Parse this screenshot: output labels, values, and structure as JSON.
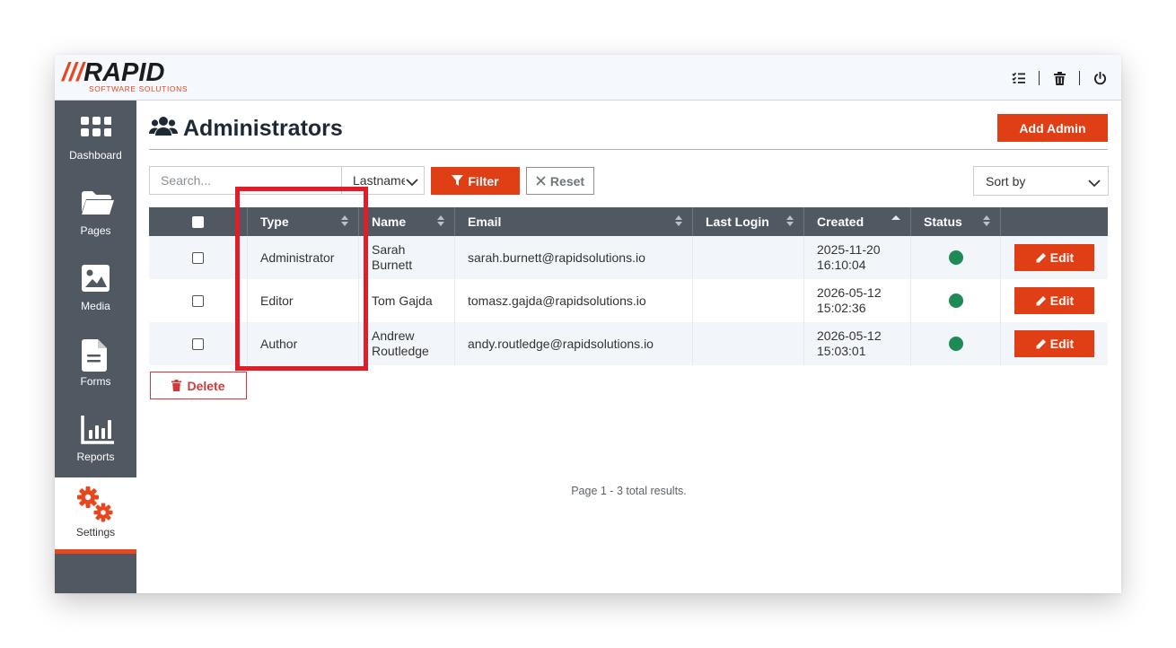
{
  "brand": {
    "name": "RAPID",
    "slashes": "///",
    "tagline": "SOFTWARE SOLUTIONS"
  },
  "topbar": {
    "icons": [
      "checklist-icon",
      "trash-icon",
      "power-icon"
    ]
  },
  "sidebar": {
    "items": [
      {
        "label": "Dashboard",
        "icon": "grid-icon",
        "active": false
      },
      {
        "label": "Pages",
        "icon": "folder-icon",
        "active": false
      },
      {
        "label": "Media",
        "icon": "image-icon",
        "active": false
      },
      {
        "label": "Forms",
        "icon": "document-icon",
        "active": false
      },
      {
        "label": "Reports",
        "icon": "bar-chart-icon",
        "active": false
      },
      {
        "label": "Settings",
        "icon": "gears-icon",
        "active": true
      }
    ]
  },
  "page": {
    "title": "Administrators",
    "add_button": "Add Admin"
  },
  "filters": {
    "search_placeholder": "Search...",
    "field_select": "Lastname",
    "filter_button": "Filter",
    "reset_button": "Reset",
    "sort_select": "Sort by"
  },
  "table": {
    "columns": [
      "Type",
      "Name",
      "Email",
      "Last Login",
      "Created",
      "Status"
    ],
    "rows": [
      {
        "type": "Administrator",
        "name_line1": "Sarah",
        "name_line2": "Burnett",
        "email": "sarah.burnett@rapidsolutions.io",
        "last_login": "",
        "created_date": "2025-11-20",
        "created_time": "16:10:04",
        "status": "active"
      },
      {
        "type": "Editor",
        "name_line1": "Tom Gajda",
        "name_line2": "",
        "email": "tomasz.gajda@rapidsolutions.io",
        "last_login": "",
        "created_date": "2026-05-12",
        "created_time": "15:02:36",
        "status": "active"
      },
      {
        "type": "Author",
        "name_line1": "Andrew",
        "name_line2": "Routledge",
        "email": "andy.routledge@rapidsolutions.io",
        "last_login": "",
        "created_date": "2026-05-12",
        "created_time": "15:03:01",
        "status": "active"
      }
    ],
    "edit_label": "Edit"
  },
  "actions": {
    "delete_label": "Delete"
  },
  "pager": {
    "text": "Page 1 - 3 total results."
  },
  "colors": {
    "accent": "#e03f16",
    "sidebar": "#505962",
    "status_active": "#1e8a55",
    "highlight": "#e01e2a"
  }
}
